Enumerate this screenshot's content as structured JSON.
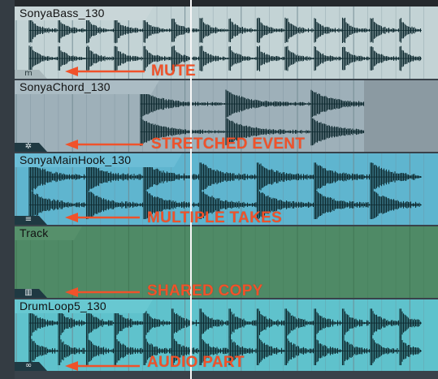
{
  "tracks": [
    {
      "id": "bass",
      "name": "SonyaBass_130",
      "badge_icon": "mute-icon",
      "badge_symbol": "m",
      "color": "#c3d3d5",
      "header_color": "#c9d6d8",
      "text": "dark"
    },
    {
      "id": "chord",
      "name": "SonyaChord_130",
      "badge_icon": "stretch-icon",
      "badge_symbol": "✲",
      "color": "#9eb0b9",
      "header_color": "#abbcc4",
      "text": "dark"
    },
    {
      "id": "mainhook",
      "name": "SonyaMainHook_130",
      "badge_icon": "takes-icon",
      "badge_symbol": "≡",
      "color": "#5fb5cf",
      "header_color": "#6cbdd6",
      "text": "dark"
    },
    {
      "id": "shared",
      "name": "Track",
      "badge_icon": "shared-copy-icon",
      "badge_symbol": "▥",
      "color": "#4f8a66",
      "header_color": "#5a9470",
      "text": "dark"
    },
    {
      "id": "drum",
      "name": "DrumLoop5_130",
      "badge_icon": "audio-part-icon",
      "badge_symbol": "∞",
      "color": "#5fc2cc",
      "header_color": "#68c8d1",
      "text": "dark"
    }
  ],
  "annotations": [
    {
      "label": "MUTE"
    },
    {
      "label": "STRETCHED EVENT"
    },
    {
      "label": "MULTIPLE TAKES"
    },
    {
      "label": "SHARED COPY"
    },
    {
      "label": "AUDIO PART"
    }
  ],
  "colors": {
    "annotation": "#f0522a",
    "waveform": "#0f2b31",
    "grid": "#7c8f95",
    "cursor": "#f7f7f7"
  }
}
